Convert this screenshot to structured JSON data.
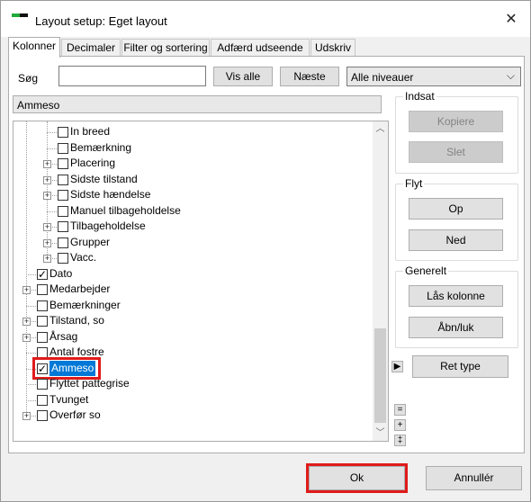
{
  "window": {
    "title": "Layout setup: Eget layout"
  },
  "tabs": [
    "Kolonner",
    "Decimaler",
    "Filter og sortering",
    "Adfærd  udseende",
    "Udskriv"
  ],
  "search": {
    "label": "Søg",
    "value": ""
  },
  "buttons": {
    "vis_alle": "Vis alle",
    "naeste": "Næste",
    "kopiere": "Kopiere",
    "slet": "Slet",
    "op": "Op",
    "ned": "Ned",
    "laas_kolonne": "Lås kolonne",
    "aabn_luk": "Åbn/luk",
    "ret_type": "Ret type",
    "ok": "Ok",
    "annuller": "Annullér"
  },
  "level_select": {
    "value": "Alle niveauer"
  },
  "path": "Ammeso",
  "groups": {
    "indsat": "Indsat",
    "flyt": "Flyt",
    "generelt": "Generelt"
  },
  "tree": [
    {
      "label": "In breed",
      "level": 2,
      "expandable": false,
      "checked": false
    },
    {
      "label": "Bemærkning",
      "level": 2,
      "expandable": false,
      "checked": false
    },
    {
      "label": "Placering",
      "level": 2,
      "expandable": true,
      "checked": false
    },
    {
      "label": "Sidste tilstand",
      "level": 2,
      "expandable": true,
      "checked": false
    },
    {
      "label": "Sidste hændelse",
      "level": 2,
      "expandable": true,
      "checked": false
    },
    {
      "label": "Manuel tilbageholdelse",
      "level": 2,
      "expandable": false,
      "checked": false
    },
    {
      "label": "Tilbageholdelse",
      "level": 2,
      "expandable": true,
      "checked": false
    },
    {
      "label": "Grupper",
      "level": 2,
      "expandable": true,
      "checked": false
    },
    {
      "label": "Vacc.",
      "level": 2,
      "expandable": true,
      "checked": false
    },
    {
      "label": "Dato",
      "level": 1,
      "expandable": false,
      "checked": true
    },
    {
      "label": "Medarbejder",
      "level": 1,
      "expandable": true,
      "checked": false
    },
    {
      "label": "Bemærkninger",
      "level": 1,
      "expandable": false,
      "checked": false
    },
    {
      "label": "Tilstand, so",
      "level": 1,
      "expandable": true,
      "checked": false
    },
    {
      "label": "Årsag",
      "level": 1,
      "expandable": true,
      "checked": false
    },
    {
      "label": "Antal fostre",
      "level": 1,
      "expandable": false,
      "checked": false
    },
    {
      "label": "Ammeso",
      "level": 1,
      "expandable": false,
      "checked": true,
      "selected": true
    },
    {
      "label": "Flyttet pattegrise",
      "level": 1,
      "expandable": false,
      "checked": false
    },
    {
      "label": "Tvunget",
      "level": 1,
      "expandable": false,
      "checked": false
    },
    {
      "label": "Overfør so",
      "level": 1,
      "expandable": true,
      "checked": false
    }
  ],
  "side_buttons": {
    "arrow_right": "▶",
    "minus": "=",
    "plus": "+",
    "both": "‡"
  },
  "colors": {
    "selected_bg": "#0078d7",
    "highlight": "#e01b1b"
  }
}
